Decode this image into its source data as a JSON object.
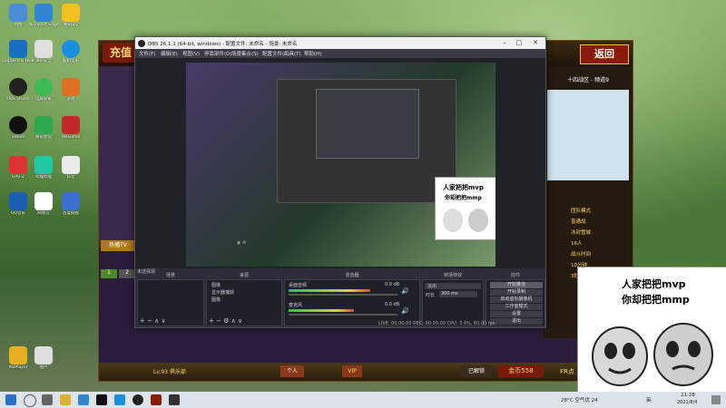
{
  "desktop": {
    "icons": [
      {
        "label": "网络"
      },
      {
        "label": "Microsoft Edge"
      },
      {
        "label": "腾讯QQ"
      },
      {
        "label": "Logitech G HUB"
      },
      {
        "label": "360安全"
      },
      {
        "label": "酷狗音乐"
      },
      {
        "label": "OBS Studio"
      },
      {
        "label": "电脑管家"
      },
      {
        "label": "游戏"
      },
      {
        "label": "Steam"
      },
      {
        "label": "腾讯会议"
      },
      {
        "label": "WeGame"
      },
      {
        "label": "GPU-Z"
      },
      {
        "label": "哔哩哔哩"
      },
      {
        "label": "抖音"
      },
      {
        "label": "QQ音乐"
      },
      {
        "label": "网易云"
      },
      {
        "label": "百度网盘"
      },
      {
        "label": "PotPlayer"
      },
      {
        "label": "图片"
      }
    ]
  },
  "game": {
    "back_label": "返回",
    "recharge_label": "充值",
    "server": "十四战区 - 频道9",
    "rows": [
      "团队模式",
      "普通战",
      "冰封雪城",
      "16人",
      "战斗时间",
      "10分钟",
      "3秒"
    ],
    "tv_label": "热播TV",
    "player_level": "Lv.93 俱乐部",
    "personal": "个人",
    "vip": "VIP",
    "shop": "已解锁",
    "gold_label": "金币558",
    "fr_label": "FR点",
    "tab1": "1",
    "tab2": "2"
  },
  "obs": {
    "title": "OBS 26.1.1 (64-bit, windows) - 配置文件: 未命名 - 场景: 未命名",
    "menu": [
      "文件(F)",
      "编辑(E)",
      "视图(V)",
      "停靠部件(D)",
      "场景集合(S)",
      "配置文件(P)",
      "工具(T)",
      "帮助(H)"
    ],
    "no_source": "未选择源",
    "panels": {
      "scenes": "场景",
      "sources": "来源",
      "mixer": "混音器",
      "transition": "转场特效",
      "controls": "控件"
    },
    "sources_list": [
      "图像",
      "显示器捕获",
      "图像"
    ],
    "mixer_tracks": [
      {
        "name": "桌面音频",
        "db": "0.0 dB",
        "level": 0.75
      },
      {
        "name": "麦克风",
        "db": "0.0 dB",
        "level": 0.6
      }
    ],
    "transition": {
      "type": "淡出",
      "duration_label": "时长",
      "duration": "300 ms"
    },
    "controls": [
      "开始推流",
      "开始录制",
      "启动虚拟摄像机",
      "工作室模式",
      "设置",
      "退出"
    ],
    "status": "LIVE: 00:00:00   REC: 00:00:00   CPU: 3.9%, 60.00 fps"
  },
  "meme": {
    "line1": "人家把把mvp",
    "line2": "你却把把mmp"
  },
  "taskbar": {
    "weather": "28°C 空气优 24",
    "time": "21:28",
    "date": "2021/8/4",
    "lang": "英"
  }
}
